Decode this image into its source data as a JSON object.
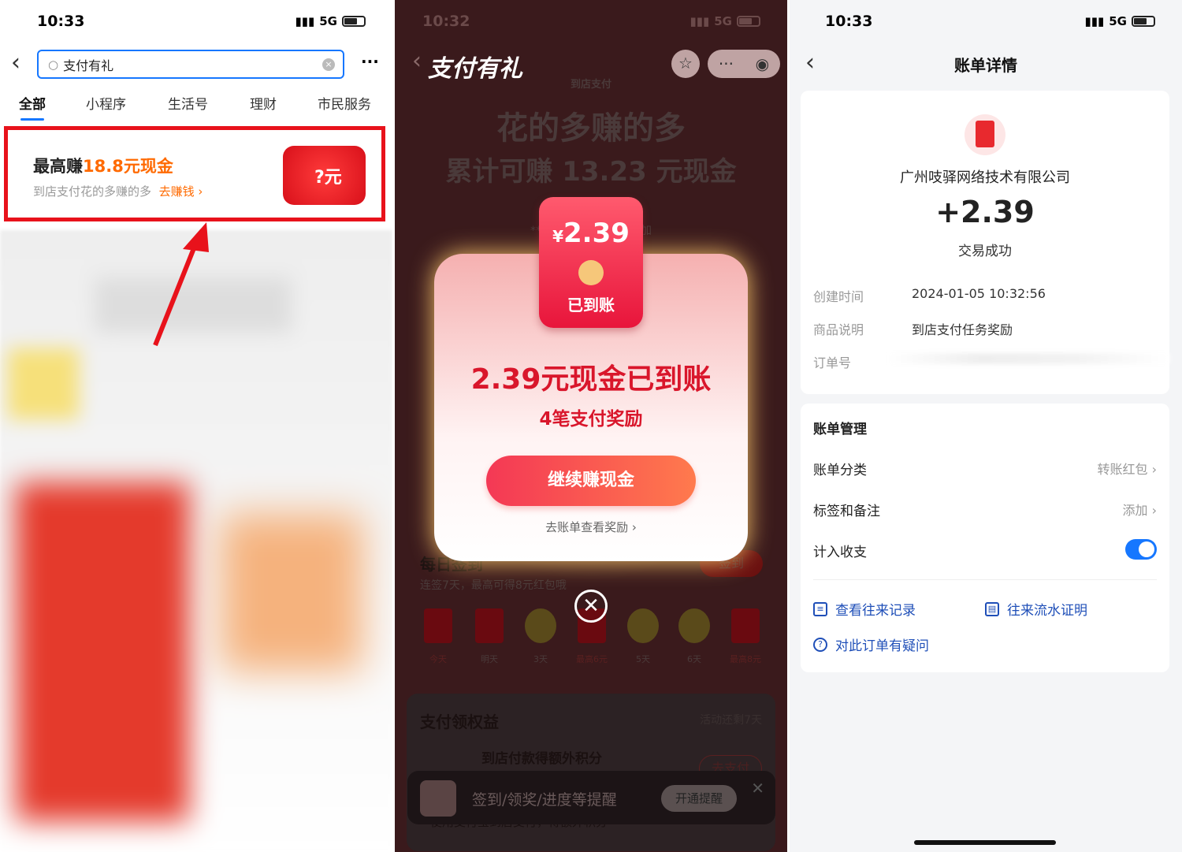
{
  "left": {
    "time": "10:33",
    "network": "5G",
    "search_value": "支付有礼",
    "tabs": [
      "全部",
      "小程序",
      "生活号",
      "理财",
      "市民服务"
    ],
    "promo": {
      "title_prefix": "最高赚",
      "title_highlight": "18.8元现金",
      "subtitle": "到店支付花的多赚的多",
      "cta": "去赚钱 ›",
      "badge": "?元"
    }
  },
  "middle": {
    "time": "10:32",
    "network": "5G",
    "title": "支付有礼",
    "bg": {
      "tag": "到店支付",
      "headline": "花的多赚的多",
      "sub": "累计可赚 13.23 元现金",
      "notice": "**月已通过…邀请你参加",
      "checkin_title": "每日签到",
      "checkin_btn": "签到",
      "checkin_desc": "连签7天，最高可得8元红包哦",
      "days": [
        "今天",
        "明天",
        "3天",
        "最高6元",
        "5天",
        "6天",
        "最高8元"
      ],
      "benefit_title": "支付领权益",
      "benefit_remaining": "活动还剩7天",
      "benefit_item": "到店付款得额外积分",
      "benefit_btn": "去支付",
      "benefit_desc": "使用支付宝到店支付，得额外积分"
    },
    "modal": {
      "amount": "2.39",
      "currency": "¥",
      "envelope_label": "已到账",
      "heading": "2.39元现金已到账",
      "sub": "4笔支付奖励",
      "button": "继续赚现金",
      "link": "去账单查看奖励 ›"
    },
    "toast": {
      "text": "签到/领奖/进度等提醒",
      "button": "开通提醒"
    }
  },
  "right": {
    "time": "10:33",
    "network": "5G",
    "title": "账单详情",
    "company": "广州吱驿网络技术有限公司",
    "amount": "+2.39",
    "status": "交易成功",
    "details": [
      {
        "label": "创建时间",
        "value": "2024-01-05 10:32:56"
      },
      {
        "label": "商品说明",
        "value": "到店支付任务奖励"
      },
      {
        "label": "订单号",
        "value": ""
      }
    ],
    "manage_title": "账单管理",
    "category_label": "账单分类",
    "category_value": "转账红包 ›",
    "tag_label": "标签和备注",
    "tag_value": "添加 ›",
    "count_label": "计入收支",
    "count_on": true,
    "links": [
      "查看往来记录",
      "往来流水证明",
      "对此订单有疑问"
    ]
  }
}
